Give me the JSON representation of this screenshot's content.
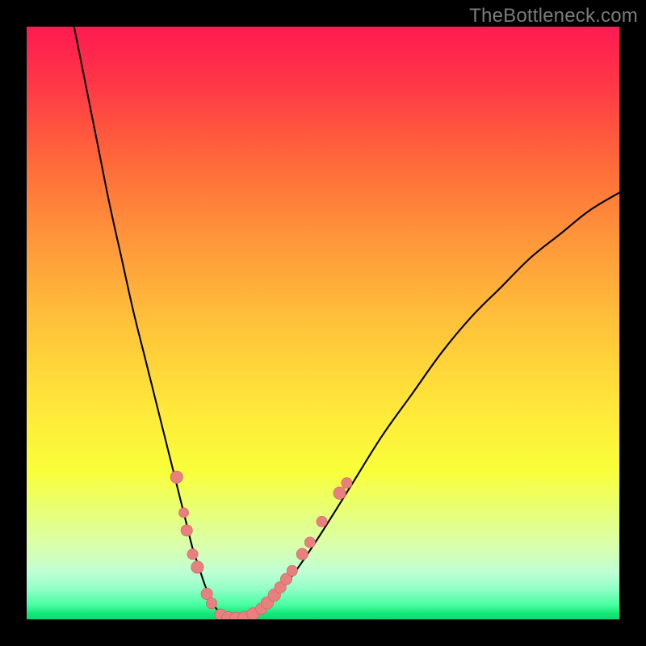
{
  "watermark": "TheBottleneck.com",
  "domain": "Chart",
  "colors": {
    "frame": "#000000",
    "curve": "#000000",
    "marker_fill": "#e98080",
    "marker_stroke": "#cb6060",
    "gradient_top": "#ff1a52",
    "gradient_bottom": "#0fd872"
  },
  "chart_data": {
    "type": "line",
    "title": "",
    "xlabel": "",
    "ylabel": "",
    "xlim": [
      0,
      100
    ],
    "ylim": [
      0,
      100
    ],
    "grid": false,
    "legend": false,
    "series": [
      {
        "name": "bottleneck-curve",
        "x": [
          8,
          10,
          12,
          14,
          16,
          18,
          20,
          22,
          24,
          26,
          27,
          28,
          29,
          30,
          31,
          32,
          33,
          34,
          35,
          37,
          39,
          41,
          43,
          46,
          50,
          55,
          60,
          65,
          70,
          75,
          80,
          85,
          90,
          95,
          100
        ],
        "y": [
          100,
          90,
          80,
          70,
          61,
          52,
          44,
          36,
          28,
          20,
          16,
          12,
          9,
          6,
          3.5,
          1.8,
          0.8,
          0.2,
          0,
          0.3,
          1.2,
          2.8,
          5,
          9,
          15,
          23,
          31,
          38,
          45,
          51,
          56,
          61,
          65,
          69,
          72
        ]
      }
    ],
    "markers": [
      {
        "x": 25.3,
        "y": 24,
        "r": 1.4
      },
      {
        "x": 26.5,
        "y": 18,
        "r": 1.1
      },
      {
        "x": 27.0,
        "y": 15,
        "r": 1.3
      },
      {
        "x": 28.0,
        "y": 11,
        "r": 1.2
      },
      {
        "x": 28.8,
        "y": 8.8,
        "r": 1.4
      },
      {
        "x": 30.4,
        "y": 4.3,
        "r": 1.3
      },
      {
        "x": 31.2,
        "y": 2.7,
        "r": 1.2
      },
      {
        "x": 32.7,
        "y": 0.8,
        "r": 1.3
      },
      {
        "x": 34.0,
        "y": 0.2,
        "r": 1.5
      },
      {
        "x": 35.4,
        "y": 0.0,
        "r": 1.6
      },
      {
        "x": 36.8,
        "y": 0.2,
        "r": 1.5
      },
      {
        "x": 38.2,
        "y": 0.9,
        "r": 1.4
      },
      {
        "x": 39.6,
        "y": 1.8,
        "r": 1.3
      },
      {
        "x": 40.6,
        "y": 2.8,
        "r": 1.4
      },
      {
        "x": 41.8,
        "y": 4.1,
        "r": 1.4
      },
      {
        "x": 42.8,
        "y": 5.4,
        "r": 1.3
      },
      {
        "x": 43.8,
        "y": 6.8,
        "r": 1.3
      },
      {
        "x": 44.8,
        "y": 8.2,
        "r": 1.2
      },
      {
        "x": 46.5,
        "y": 11.0,
        "r": 1.3
      },
      {
        "x": 47.8,
        "y": 13.0,
        "r": 1.2
      },
      {
        "x": 49.8,
        "y": 16.5,
        "r": 1.2
      },
      {
        "x": 52.8,
        "y": 21.3,
        "r": 1.4
      },
      {
        "x": 54.0,
        "y": 23.0,
        "r": 1.2
      }
    ]
  }
}
